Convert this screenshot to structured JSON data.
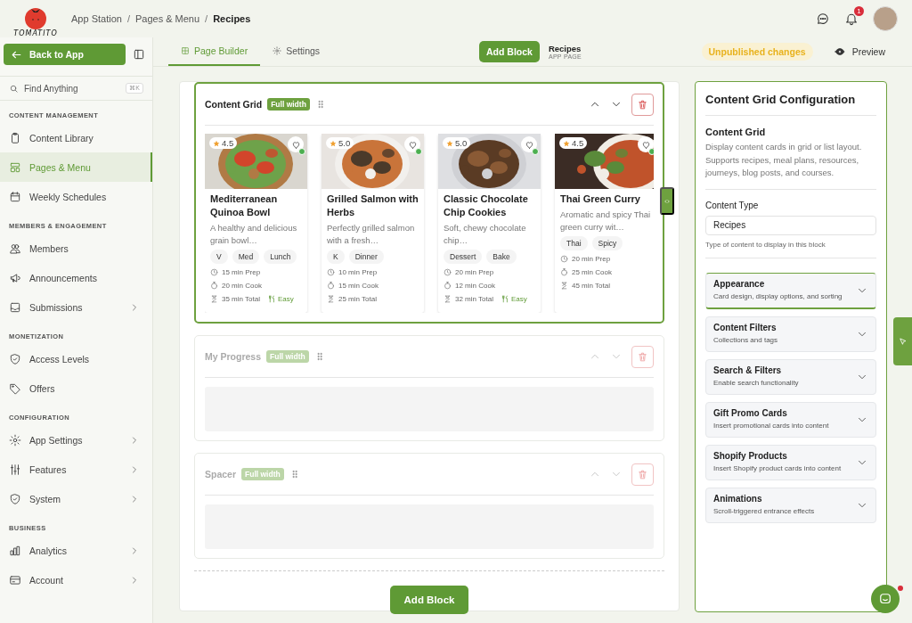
{
  "header": {
    "logo_text": "TOMATITO",
    "breadcrumbs": [
      {
        "label": "App Station",
        "current": false
      },
      {
        "label": "Pages & Menu",
        "current": false
      },
      {
        "label": "Recipes",
        "current": true
      }
    ],
    "separator": "/",
    "notifications": "1"
  },
  "sidebar": {
    "back_button": "Back to App",
    "search": {
      "placeholder": "Find Anything",
      "shortcut": "⌘K"
    },
    "sections": [
      {
        "title": "CONTENT MANAGEMENT",
        "items": [
          {
            "label": "Content Library",
            "selected": false,
            "expandable": false
          },
          {
            "label": "Pages & Menu",
            "selected": true,
            "expandable": false
          },
          {
            "label": "Weekly Schedules",
            "selected": false,
            "expandable": false
          }
        ]
      },
      {
        "title": "MEMBERS & ENGAGEMENT",
        "items": [
          {
            "label": "Members",
            "selected": false,
            "expandable": false
          },
          {
            "label": "Announcements",
            "selected": false,
            "expandable": false
          },
          {
            "label": "Submissions",
            "selected": false,
            "expandable": true
          }
        ]
      },
      {
        "title": "MONETIZATION",
        "items": [
          {
            "label": "Access Levels",
            "selected": false,
            "expandable": false
          },
          {
            "label": "Offers",
            "selected": false,
            "expandable": false
          }
        ]
      },
      {
        "title": "CONFIGURATION",
        "items": [
          {
            "label": "App Settings",
            "selected": false,
            "expandable": true
          },
          {
            "label": "Features",
            "selected": false,
            "expandable": true
          },
          {
            "label": "System",
            "selected": false,
            "expandable": true
          }
        ]
      },
      {
        "title": "BUSINESS",
        "items": [
          {
            "label": "Analytics",
            "selected": false,
            "expandable": true
          },
          {
            "label": "Account",
            "selected": false,
            "expandable": true
          }
        ]
      }
    ]
  },
  "toolbar": {
    "tabs": [
      {
        "label": "Page Builder",
        "selected": true
      },
      {
        "label": "Settings",
        "selected": false
      }
    ],
    "add_button": "Add Block",
    "page_title": "Recipes",
    "page_type": "APP PAGE",
    "status": "Unpublished changes",
    "preview": "Preview"
  },
  "canvas": {
    "blocks": [
      {
        "kind": "grid",
        "title": "Content Grid",
        "badge": "Full width",
        "selected": true,
        "cards": [
          {
            "image": {
              "kind": "picture"
            },
            "rating": "4.5",
            "title": "Mediterranean Quinoa Bowl",
            "description": "A healthy and delicious grain bowl…",
            "tags": [
              "V",
              "Med",
              "Lunch"
            ],
            "prep": "15 min Prep",
            "cook": "20 min Cook",
            "total": "35 min Total",
            "difficulty": "Easy"
          },
          {
            "image": {
              "kind": "picture"
            },
            "rating": "5.0",
            "title": "Grilled Salmon with Herbs",
            "description": "Perfectly grilled salmon with a fresh…",
            "tags": [
              "K",
              "Dinner"
            ],
            "prep": "10 min Prep",
            "cook": "15 min Cook",
            "total": "25 min Total"
          },
          {
            "image": {
              "kind": "picture"
            },
            "rating": "5.0",
            "title": "Classic Chocolate Chip Cookies",
            "description": "Soft, chewy chocolate chip…",
            "tags": [
              "Dessert",
              "Bake"
            ],
            "prep": "20 min Prep",
            "cook": "12 min Cook",
            "total": "32 min Total",
            "difficulty": "Easy"
          },
          {
            "image": {
              "kind": "picture"
            },
            "rating": "4.5",
            "title": "Thai Green Curry",
            "description": "Aromatic and spicy Thai green curry wit…",
            "tags": [
              "Thai",
              "Spicy"
            ],
            "prep": "20 min Prep",
            "cook": "25 min Cook",
            "total": "45 min Total"
          }
        ]
      },
      {
        "kind": "empty",
        "title": "My Progress",
        "badge": "Full width",
        "selected": false
      },
      {
        "kind": "empty",
        "title": "Spacer",
        "badge": "Full width",
        "selected": false
      }
    ],
    "add_button": "Add Block"
  },
  "config": {
    "title": "Content Grid Configuration",
    "block_name": "Content Grid",
    "block_description": "Display content cards in grid or list layout. Supports recipes, meal plans, resources, journeys, blog posts, and courses.",
    "content_type": {
      "label": "Content Type",
      "value": "Recipes",
      "hint": "Type of content to display in this block"
    },
    "sections": [
      {
        "title": "Appearance",
        "subtitle": "Card design, display options, and sorting",
        "selected": true
      },
      {
        "title": "Content Filters",
        "subtitle": "Collections and tags",
        "selected": false
      },
      {
        "title": "Search & Filters",
        "subtitle": "Enable search functionality",
        "selected": false
      },
      {
        "title": "Gift Promo Cards",
        "subtitle": "Insert promotional cards into content",
        "selected": false
      },
      {
        "title": "Shopify Products",
        "subtitle": "Insert Shopify product cards into content",
        "selected": false
      },
      {
        "title": "Animations",
        "subtitle": "Scroll-triggered entrance effects",
        "selected": false
      }
    ]
  }
}
